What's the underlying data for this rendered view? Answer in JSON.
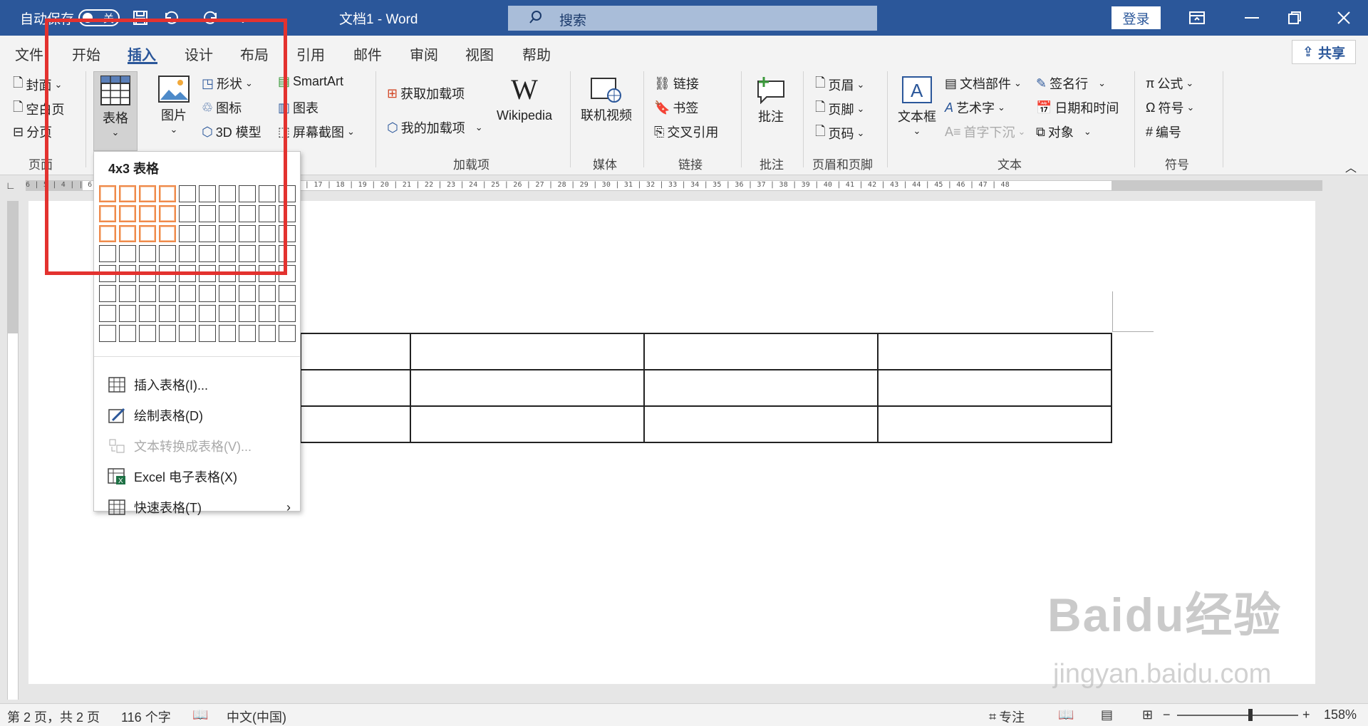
{
  "titlebar": {
    "autosave_label": "自动保存",
    "autosave_state": "关",
    "doc_title": "文档1  -  Word",
    "search_placeholder": "搜索",
    "login_label": "登录"
  },
  "tabs": [
    {
      "label": "文件"
    },
    {
      "label": "开始"
    },
    {
      "label": "插入",
      "active": true
    },
    {
      "label": "设计"
    },
    {
      "label": "布局"
    },
    {
      "label": "引用"
    },
    {
      "label": "邮件"
    },
    {
      "label": "审阅"
    },
    {
      "label": "视图"
    },
    {
      "label": "帮助"
    }
  ],
  "share_label": "共享",
  "ribbon": {
    "pages": {
      "cover": "封面",
      "blank": "空白页",
      "break": "分页",
      "group": "页面"
    },
    "tables": {
      "table": "表格"
    },
    "illustrations": {
      "picture": "图片",
      "shapes": "形状",
      "icons": "图标",
      "model3d": "3D 模型",
      "smartart": "SmartArt",
      "chart": "图表",
      "screenshot": "屏幕截图"
    },
    "addins": {
      "get": "获取加载项",
      "mine": "我的加载项",
      "wikipedia": "Wikipedia",
      "group": "加载项"
    },
    "media": {
      "video": "联机视频",
      "group": "媒体"
    },
    "links": {
      "link": "链接",
      "bookmark": "书签",
      "crossref": "交叉引用",
      "group": "链接"
    },
    "comments": {
      "comment": "批注",
      "group": "批注"
    },
    "headerfooter": {
      "header": "页眉",
      "footer": "页脚",
      "pagenum": "页码",
      "group": "页眉和页脚"
    },
    "text": {
      "textbox": "文本框",
      "parts": "文档部件",
      "wordart": "艺术字",
      "dropcap": "首字下沉",
      "sigline": "签名行",
      "datetime": "日期和时间",
      "object": "对象",
      "group": "文本"
    },
    "symbols": {
      "equation": "公式",
      "symbol": "符号",
      "number": "编号",
      "group": "符号"
    }
  },
  "ruler_text": "6 | 5 | 4 |                                                   | 6 | 7 | 8 | 9 | 10 | 11 | 12 | 13 | 14 | 15 | 16 | 17 | 18 | 19 | 20 | 21 | 22 | 23 | 24 | 25 | 26 | 27 | 28 | 29 | 30 | 31 | 32 | 33 | 34 | 35 | 36 | 37 | 38 | 39 |  40 | 41 | 42 | 43 | 44 | 45 | 46 | 47 | 48",
  "table_dropdown": {
    "title": "4x3 表格",
    "grid_cols": 10,
    "grid_rows": 8,
    "selected_cols": 4,
    "selected_rows": 3,
    "items": [
      {
        "label": "插入表格(I)...",
        "enabled": true
      },
      {
        "label": "绘制表格(D)",
        "enabled": true
      },
      {
        "label": "文本转换成表格(V)...",
        "enabled": false
      },
      {
        "label": "Excel 电子表格(X)",
        "enabled": true
      },
      {
        "label": "快速表格(T)",
        "enabled": true,
        "submenu": true
      }
    ]
  },
  "status": {
    "page": "第 2 页，共 2 页",
    "words": "116 个字",
    "language": "中文(中国)",
    "focus": "专注",
    "zoom": "158%"
  },
  "watermark": {
    "brand": "Baidu经验",
    "url": "jingyan.baidu.com"
  },
  "colors": {
    "word_blue": "#2b579a",
    "highlight_red": "#e3322f",
    "grid_select": "#ef8a4b"
  }
}
